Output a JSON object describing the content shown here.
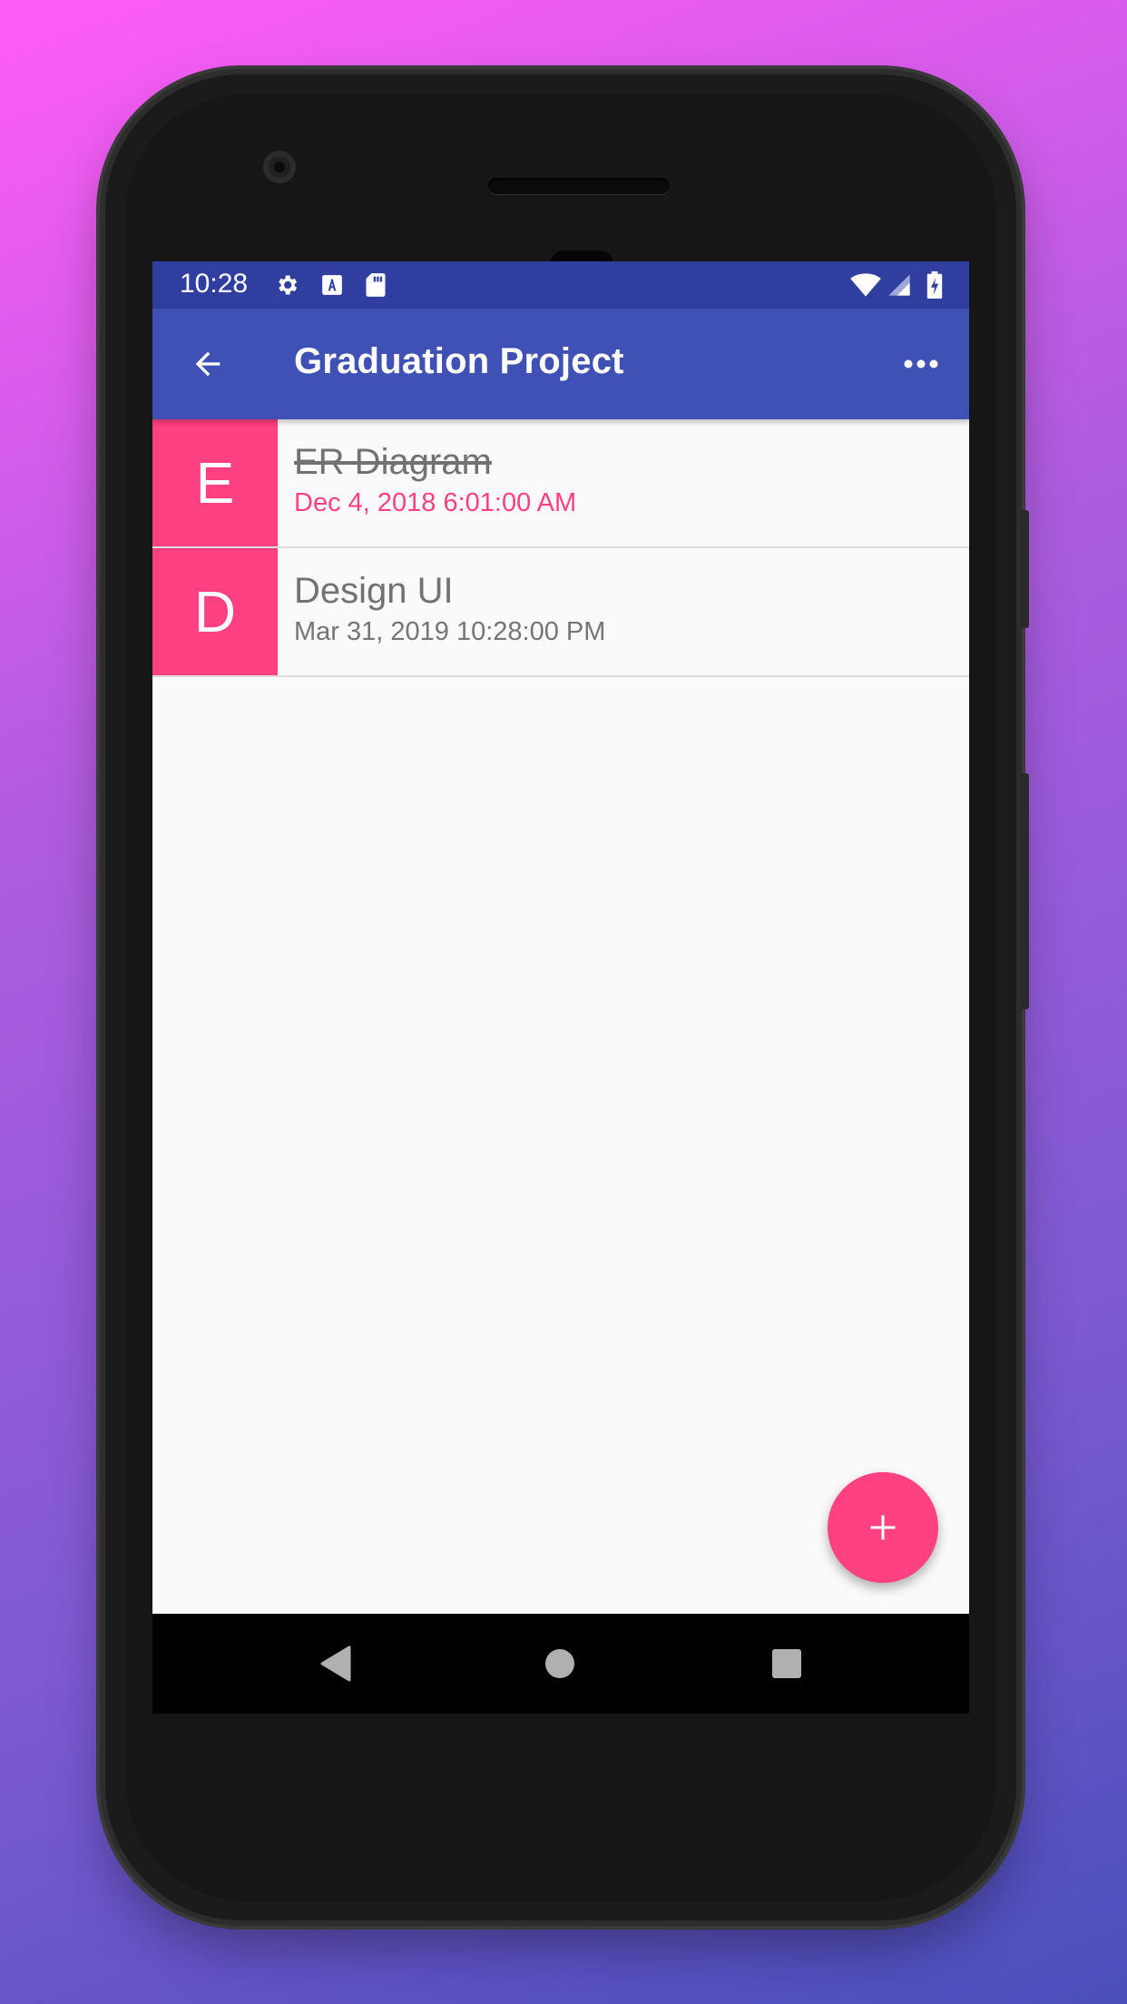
{
  "status_bar": {
    "time": "10:28",
    "left_icons": [
      "gear-icon",
      "a-notification-icon",
      "sd-card-icon"
    ],
    "right_icons": [
      "wifi-icon",
      "cell-signal-icon",
      "battery-charging-icon"
    ]
  },
  "app_bar": {
    "title": "Graduation Project",
    "back_icon": "arrow-left-icon",
    "overflow_icon": "more-horizontal-icon"
  },
  "tasks": [
    {
      "letter": "E",
      "title": "ER Diagram",
      "date": "Dec 4, 2018 6:01:00 AM",
      "completed": true,
      "overdue": true
    },
    {
      "letter": "D",
      "title": "Design UI",
      "date": "Mar 31, 2019 10:28:00 PM",
      "completed": false,
      "overdue": false
    }
  ],
  "fab": {
    "icon": "plus-icon"
  },
  "nav_bar": {
    "buttons": [
      "back-triangle-icon",
      "home-circle-icon",
      "recents-square-icon"
    ]
  },
  "colors": {
    "primary": "#3f51b5",
    "primary_dark": "#303f9f",
    "accent": "#ff4081",
    "background": "#fafafa"
  }
}
